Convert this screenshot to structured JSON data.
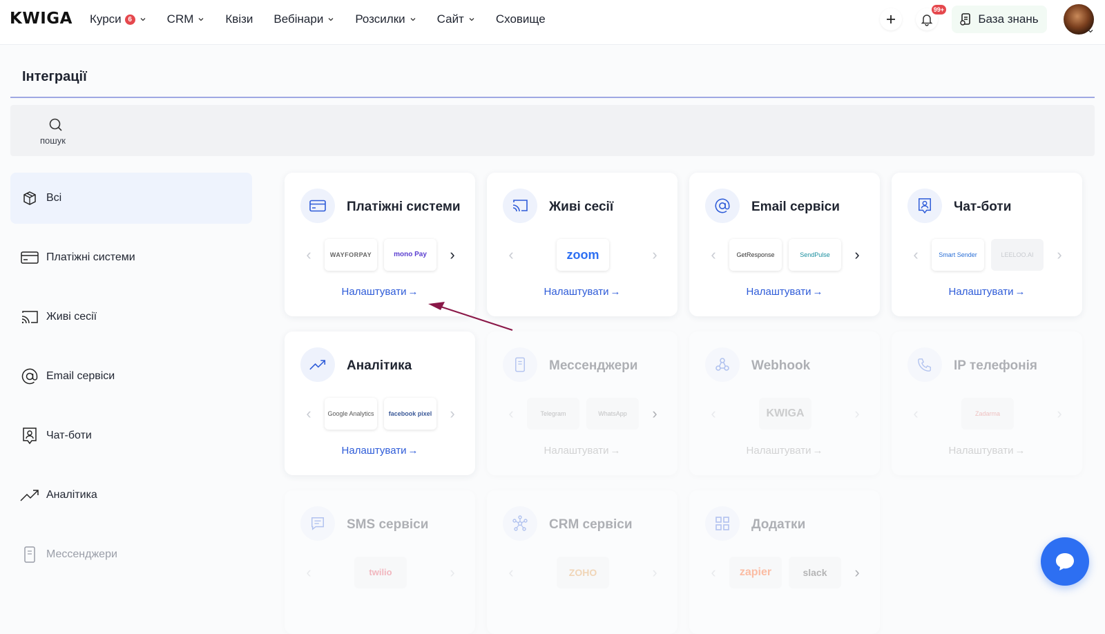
{
  "header": {
    "logo": "KWIGA",
    "nav": [
      {
        "label": "Курси",
        "badge": "6",
        "dropdown": true
      },
      {
        "label": "CRM",
        "dropdown": true
      },
      {
        "label": "Квізи",
        "dropdown": false
      },
      {
        "label": "Вебінари",
        "dropdown": true
      },
      {
        "label": "Розсилки",
        "dropdown": true
      },
      {
        "label": "Сайт",
        "dropdown": true
      },
      {
        "label": "Сховище",
        "dropdown": false
      }
    ],
    "notifications_badge": "99+",
    "knowledge_base_label": "База знань"
  },
  "page": {
    "title": "Інтеграції",
    "search_label": "пошук"
  },
  "sidebar": {
    "items": [
      {
        "label": "Всі",
        "icon": "box-icon",
        "active": true
      },
      {
        "label": "Платіжні системи",
        "icon": "credit-card-icon"
      },
      {
        "label": "Живі сесії",
        "icon": "cast-icon"
      },
      {
        "label": "Email сервіси",
        "icon": "at-sign-icon"
      },
      {
        "label": "Чат-боти",
        "icon": "chat-bot-icon"
      },
      {
        "label": "Аналітика",
        "icon": "trending-up-icon"
      },
      {
        "label": "Мессенджери",
        "icon": "phone-device-icon",
        "muted": true
      }
    ]
  },
  "cards": [
    {
      "title": "Платіжні системи",
      "icon": "credit-card-icon",
      "logos": [
        "WAYFORPAY",
        "mono Pay"
      ],
      "link": "Налаштувати",
      "dim": false,
      "next": true
    },
    {
      "title": "Живі сесії",
      "icon": "cast-icon",
      "logos": [
        "zoom"
      ],
      "link": "Налаштувати",
      "dim": false,
      "next": false
    },
    {
      "title": "Email сервіси",
      "icon": "at-sign-icon",
      "logos": [
        "GetResponse",
        "SendPulse"
      ],
      "link": "Налаштувати",
      "dim": false,
      "next": true
    },
    {
      "title": "Чат-боти",
      "icon": "chat-bot-icon",
      "logos": [
        "Smart Sender",
        "LEELOO.AI"
      ],
      "link": "Налаштувати",
      "dim": false,
      "next": false
    },
    {
      "title": "Аналітика",
      "icon": "trending-up-icon",
      "logos": [
        "Google Analytics",
        "facebook pixel"
      ],
      "link": "Налаштувати",
      "dim": false,
      "next": false
    },
    {
      "title": "Мессенджери",
      "icon": "phone-device-icon",
      "logos": [
        "Telegram",
        "WhatsApp"
      ],
      "link": "Налаштувати",
      "dim": true,
      "next": true
    },
    {
      "title": "Webhook",
      "icon": "webhook-icon",
      "logos": [
        "KWIGA"
      ],
      "link": "Налаштувати",
      "dim": true,
      "next": false
    },
    {
      "title": "IP телефонія",
      "icon": "phone-call-icon",
      "logos": [
        "Zadarma"
      ],
      "link": "Налаштувати",
      "dim": true,
      "next": false
    },
    {
      "title": "SMS сервіси",
      "icon": "message-icon",
      "logos": [
        "twilio"
      ],
      "link": "Налаштувати",
      "dim": true,
      "next": false
    },
    {
      "title": "CRM сервіси",
      "icon": "network-icon",
      "logos": [
        "ZOHO"
      ],
      "link": "Налаштувати",
      "dim": true,
      "next": false
    },
    {
      "title": "Додатки",
      "icon": "grid-icon",
      "logos": [
        "zapier",
        "slack"
      ],
      "link": "Налаштувати",
      "dim": true,
      "next": true
    }
  ],
  "colors": {
    "accent": "#2d5bd8",
    "annotation_arrow": "#8a1848",
    "chat": "#2d6ff2"
  }
}
